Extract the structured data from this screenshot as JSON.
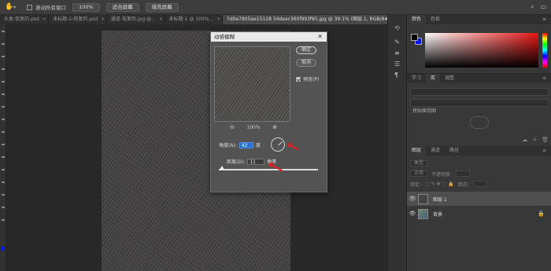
{
  "options_bar": {
    "hand_icon": "hand-icon",
    "scroll_all_label": "滚动所有窗口",
    "buttons": [
      "100%",
      "适合屏幕",
      "填充屏幕"
    ]
  },
  "tabs": [
    {
      "label": "头发-恢复的.psd",
      "active": false
    },
    {
      "label": "未标题-2-恢复的.psd",
      "active": false
    },
    {
      "label": "通道-恢复的.jpg @...",
      "active": false
    },
    {
      "label": "未标题-1 @ 100%...",
      "active": false
    },
    {
      "label": "7d0e7805ae15128 34deac360f993f85.jpg @ 39.1% (图层 1, RGB/8#)",
      "active": true
    }
  ],
  "dialog": {
    "title": "动感模糊",
    "ok_label": "确定",
    "cancel_label": "取消",
    "preview_label": "预览(P)",
    "zoom_percent": "100%",
    "angle_label": "角度(A):",
    "angle_value": "42",
    "angle_unit": "度",
    "distance_label": "距离(D):",
    "distance_value": "11",
    "distance_unit": "像素",
    "distance_slider_fraction": 0.01
  },
  "color_panel": {
    "tabs": [
      "颜色",
      "色板"
    ],
    "foreground": "#000000",
    "background": "#0014ff"
  },
  "library_panel": {
    "tabs": [
      "学习",
      "库",
      "调整"
    ],
    "dropdown": "拼贴面视图"
  },
  "layers_panel": {
    "tabs": [
      "图层",
      "通道",
      "路径"
    ],
    "kind_label": "类型",
    "blend_mode": "正常",
    "opacity_label": "不透明度:",
    "lock_label": "锁定:",
    "fill_label": "填充:",
    "layers": [
      {
        "name": "图层 1",
        "selected": true
      },
      {
        "name": "背景",
        "selected": false
      }
    ]
  }
}
